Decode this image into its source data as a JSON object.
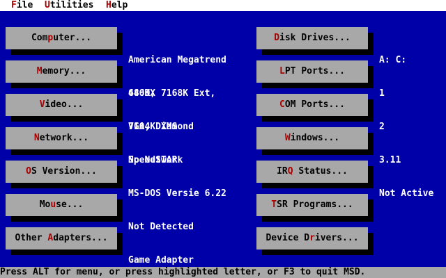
{
  "menu": {
    "file": {
      "hotkey": "F",
      "rest": "ile"
    },
    "utilities": {
      "hotkey": "U",
      "rest": "tilities"
    },
    "help": {
      "hotkey": "H",
      "rest": "elp"
    }
  },
  "left_buttons": {
    "computer": {
      "pre": "Com",
      "hotkey": "p",
      "post": "uter..."
    },
    "memory": {
      "pre": "",
      "hotkey": "M",
      "post": "emory..."
    },
    "video": {
      "pre": "",
      "hotkey": "V",
      "post": "ideo..."
    },
    "network": {
      "pre": "",
      "hotkey": "N",
      "post": "etwork..."
    },
    "os": {
      "pre": "",
      "hotkey": "O",
      "post": "S Version..."
    },
    "mouse": {
      "pre": "Mo",
      "hotkey": "u",
      "post": "se..."
    },
    "adapters": {
      "pre": "Other ",
      "hotkey": "A",
      "post": "dapters..."
    }
  },
  "left_info": {
    "computer": [
      "American Megatrend",
      "486DX"
    ],
    "memory": [
      "640K, 7168K Ext,",
      "7104K XMS"
    ],
    "video": [
      "VGA, Diamond",
      "SpeedSTAR"
    ],
    "network": [
      "No Network"
    ],
    "os": [
      "MS-DOS Versie 6.22"
    ],
    "mouse": [
      "Not Detected"
    ],
    "adapters": [
      "Game Adapter"
    ]
  },
  "right_buttons": {
    "disk": {
      "pre": "",
      "hotkey": "D",
      "post": "isk Drives..."
    },
    "lpt": {
      "pre": "",
      "hotkey": "L",
      "post": "PT Ports..."
    },
    "com": {
      "pre": "",
      "hotkey": "C",
      "post": "OM Ports..."
    },
    "windows": {
      "pre": "",
      "hotkey": "W",
      "post": "indows..."
    },
    "irq": {
      "pre": "IR",
      "hotkey": "Q",
      "post": " Status..."
    },
    "tsr": {
      "pre": "",
      "hotkey": "T",
      "post": "SR Programs..."
    },
    "drivers": {
      "pre": "Device D",
      "hotkey": "r",
      "post": "ivers..."
    }
  },
  "right_info": {
    "disk": [
      "A: C:"
    ],
    "lpt": [
      "1"
    ],
    "com": [
      "2"
    ],
    "windows": [
      "3.11",
      "Not Active"
    ]
  },
  "status_bar": "Press ALT for menu, or press highlighted letter, or F3 to quit MSD.",
  "colors": {
    "background": "#0000a8",
    "button": "#a8a8a8",
    "hotkey": "#a80000",
    "shadow": "#000000",
    "text": "#ffffff"
  }
}
